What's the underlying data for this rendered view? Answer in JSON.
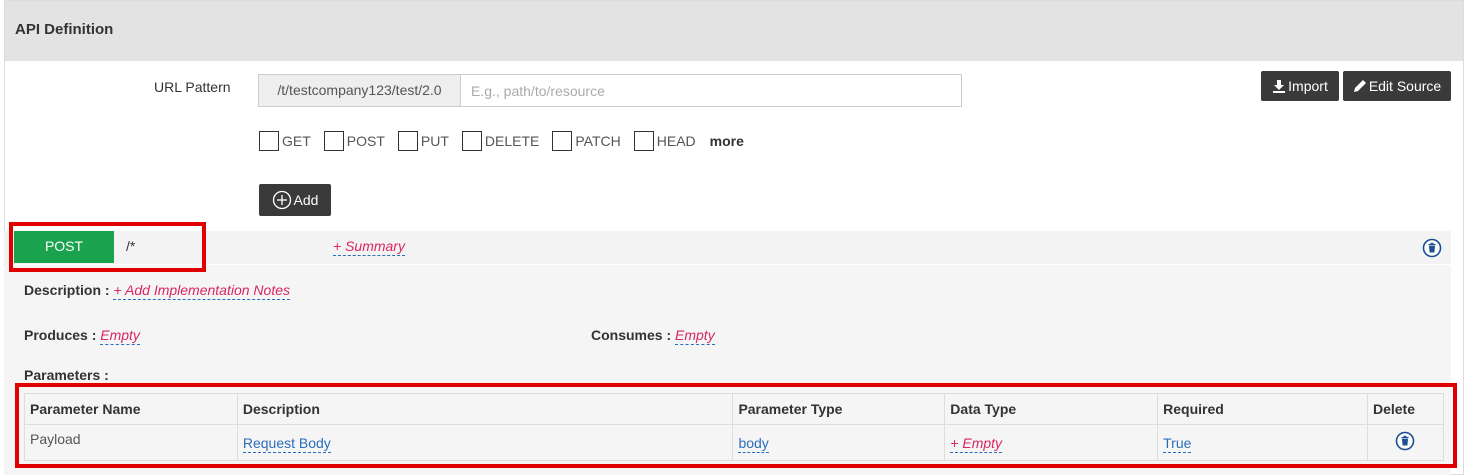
{
  "panel": {
    "title": "API Definition"
  },
  "url": {
    "label": "URL Pattern",
    "prefix": "/t/testcompany123/test/2.0",
    "placeholder": "E.g., path/to/resource",
    "value": ""
  },
  "toolbar": {
    "import_label": "Import",
    "edit_source_label": "Edit Source"
  },
  "methods": [
    {
      "label": "GET",
      "checked": false
    },
    {
      "label": "POST",
      "checked": false
    },
    {
      "label": "PUT",
      "checked": false
    },
    {
      "label": "DELETE",
      "checked": false
    },
    {
      "label": "PATCH",
      "checked": false
    },
    {
      "label": "HEAD",
      "checked": false
    }
  ],
  "more_label": "more",
  "add_label": "Add",
  "resource": {
    "method": "POST",
    "path": "/*",
    "summary_link": "+ Summary",
    "method_color": "#1aa24f"
  },
  "operation": {
    "description_label": "Description :",
    "description_link": "+ Add Implementation Notes",
    "produces_label": "Produces :",
    "produces_value": "Empty",
    "consumes_label": "Consumes :",
    "consumes_value": "Empty",
    "parameters_label": "Parameters :"
  },
  "parameters_table": {
    "headers": [
      "Parameter Name",
      "Description",
      "Parameter Type",
      "Data Type",
      "Required",
      "Delete"
    ],
    "rows": [
      {
        "name": "Payload",
        "description": "Request Body",
        "param_type": "body",
        "data_type": "+ Empty",
        "required": "True"
      }
    ]
  },
  "colors": {
    "accent_link": "#2a6ebb",
    "pink_link": "#d9265f",
    "highlight": "#e00000",
    "dark_button": "#3a3a3a"
  }
}
